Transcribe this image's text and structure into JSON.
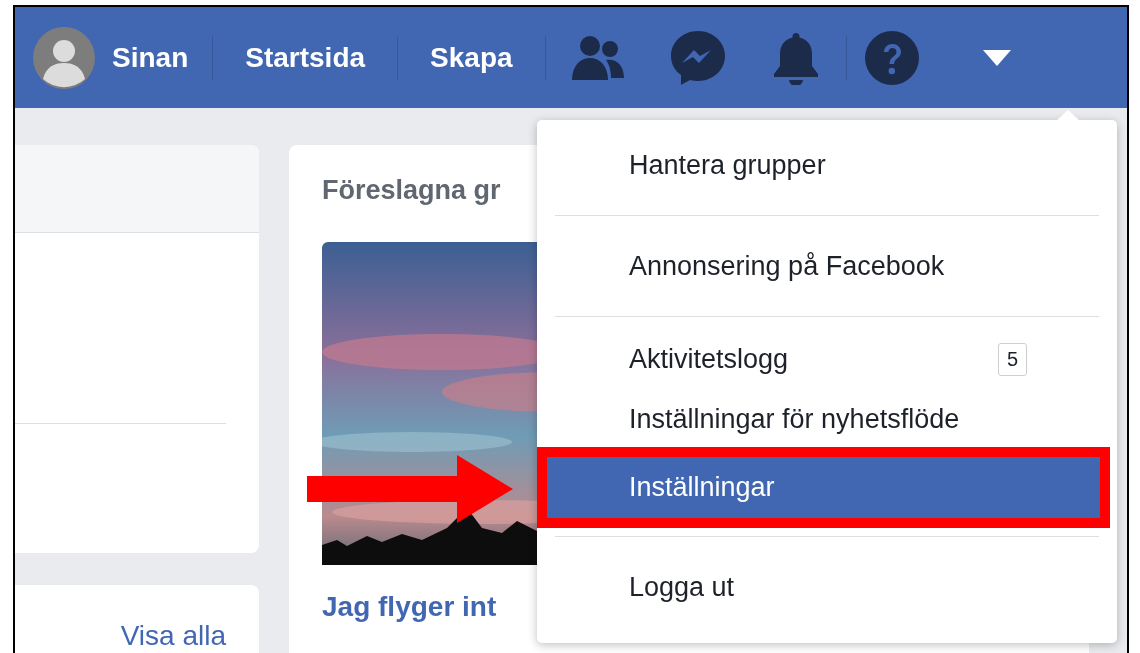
{
  "header": {
    "profile_name": "Sinan",
    "nav_links": [
      "Startsida",
      "Skapa"
    ]
  },
  "left_panel": {
    "link": "Visa alla"
  },
  "suggested_groups": {
    "title": "Föreslagna gr",
    "group_title": "Jag flyger int"
  },
  "menu": {
    "items": [
      {
        "label": "Hantera grupper",
        "selected": false,
        "divider_after": true
      },
      {
        "label": "Annonsering på Facebook",
        "selected": false,
        "divider_after": true
      },
      {
        "label": "Aktivitetslogg",
        "badge": "5",
        "selected": false,
        "divider_after": false
      },
      {
        "label": "Inställningar för nyhetsflöde",
        "selected": false,
        "divider_after": false
      },
      {
        "label": "Inställningar",
        "selected": true,
        "divider_after": true
      },
      {
        "label": "Logga ut",
        "selected": false,
        "divider_after": false
      }
    ]
  }
}
